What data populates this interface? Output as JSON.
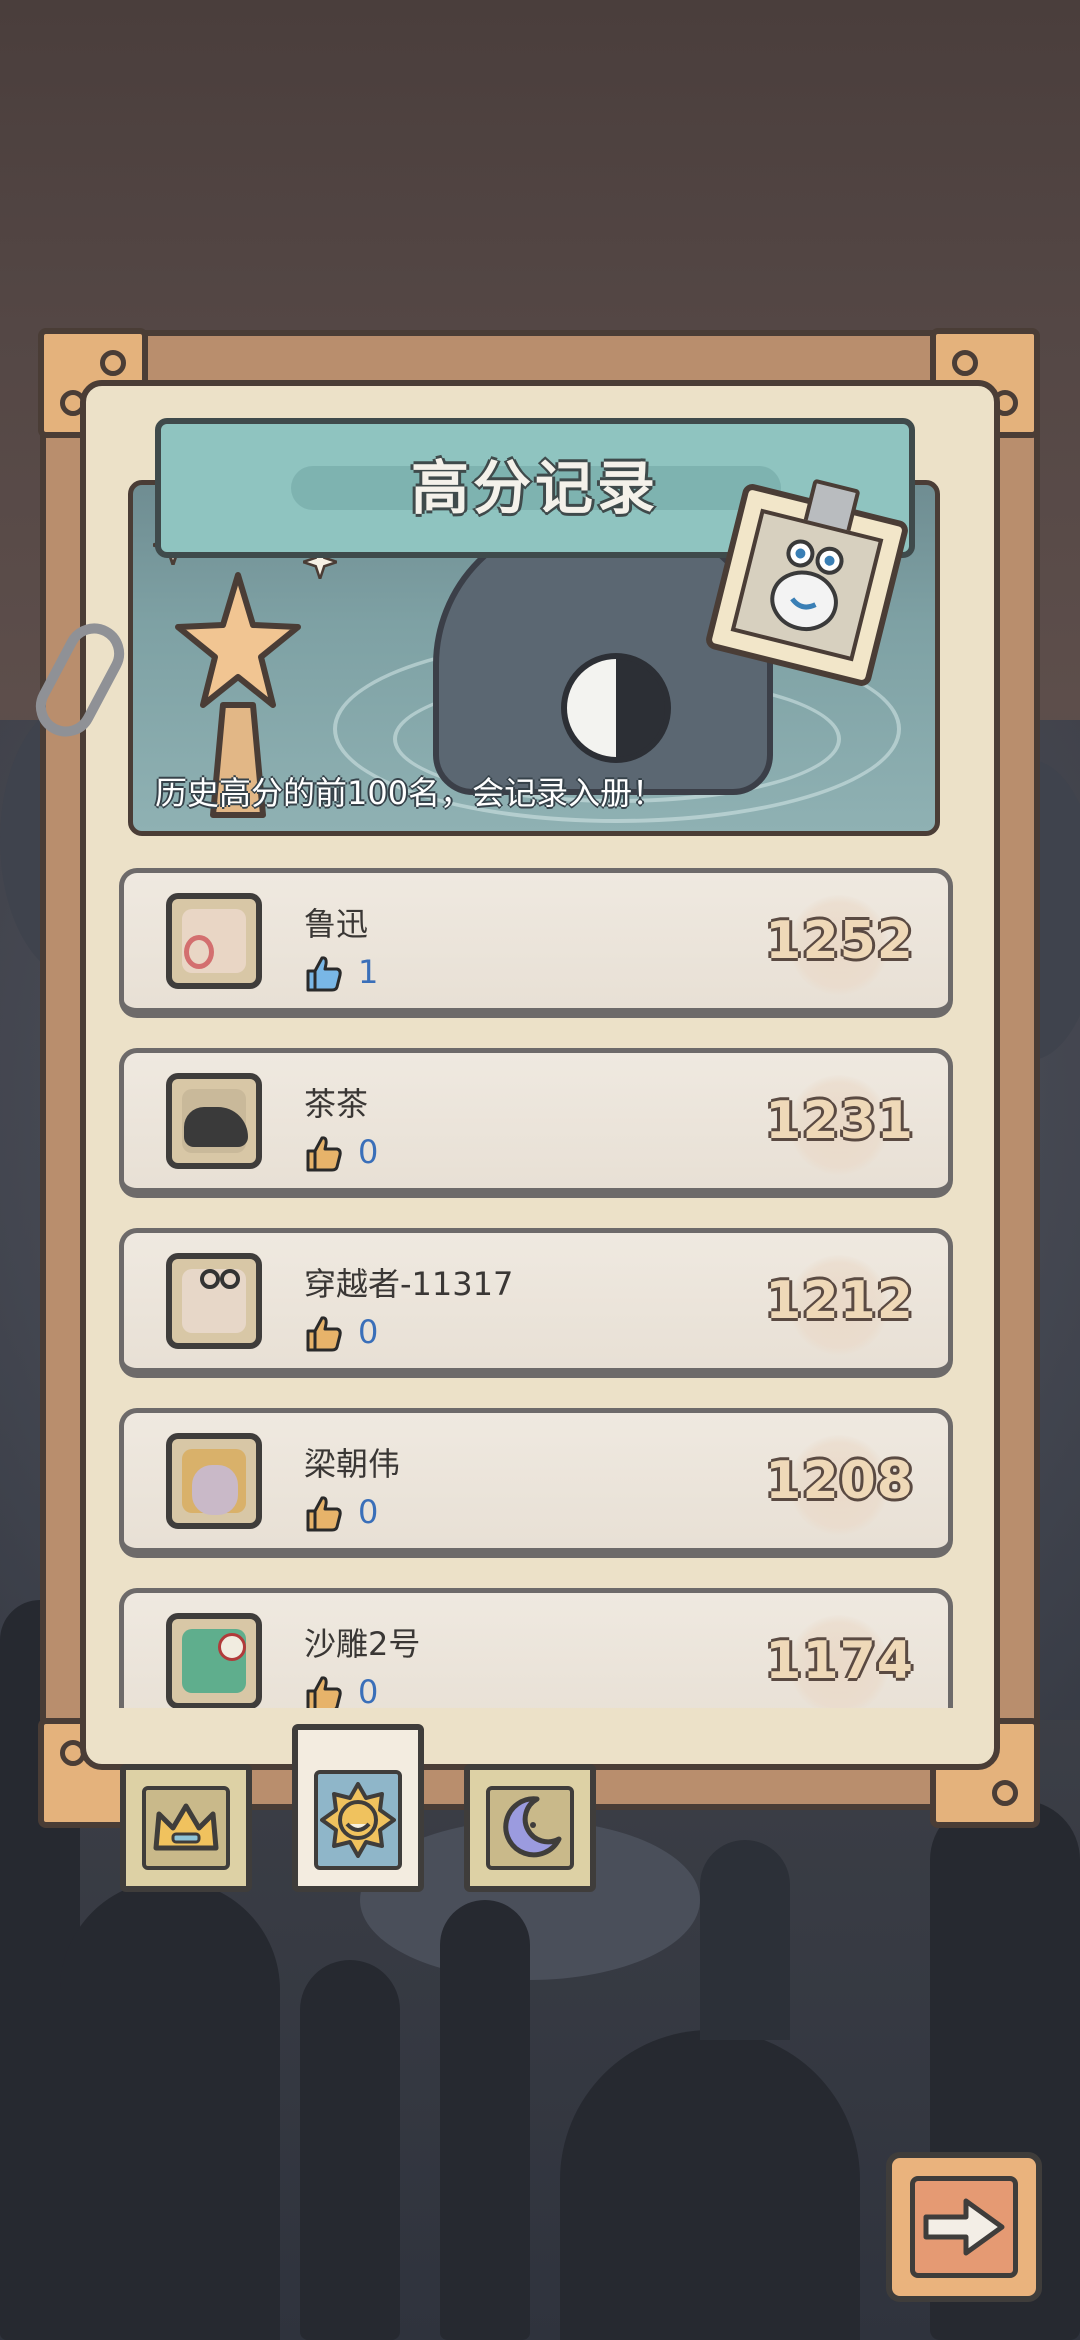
{
  "title": "高分记录",
  "subtitle": "历史高分的前100名，会记录入册！",
  "colors": {
    "ribbon": "#8fc4c0",
    "score_fill": "#efd9b8",
    "like_blue": "#3a6fb9",
    "frame": "#b98e6d"
  },
  "leaderboard": [
    {
      "name": "鲁迅",
      "likes": "1",
      "score": "1252",
      "like_icon": "thumbs-up-icon-blue",
      "avatar_icon": "snail-avatar-icon"
    },
    {
      "name": "茶茶",
      "likes": "0",
      "score": "1231",
      "like_icon": "thumbs-up-icon",
      "avatar_icon": "dragon-avatar-icon"
    },
    {
      "name": "穿越者-11317",
      "likes": "0",
      "score": "1212",
      "like_icon": "thumbs-up-icon",
      "avatar_icon": "snail-avatar-icon"
    },
    {
      "name": "梁朝伟",
      "likes": "0",
      "score": "1208",
      "like_icon": "thumbs-up-icon",
      "avatar_icon": "blond-character-avatar-icon"
    },
    {
      "name": "沙雕2号",
      "likes": "0",
      "score": "1174",
      "like_icon": "thumbs-up-icon",
      "avatar_icon": "zombie-avatar-icon"
    }
  ],
  "tabs": [
    {
      "icon": "crown-icon",
      "active": false
    },
    {
      "icon": "sun-face-icon",
      "active": true
    },
    {
      "icon": "moon-face-icon",
      "active": false
    }
  ],
  "next_button": {
    "icon": "arrow-right-icon"
  }
}
